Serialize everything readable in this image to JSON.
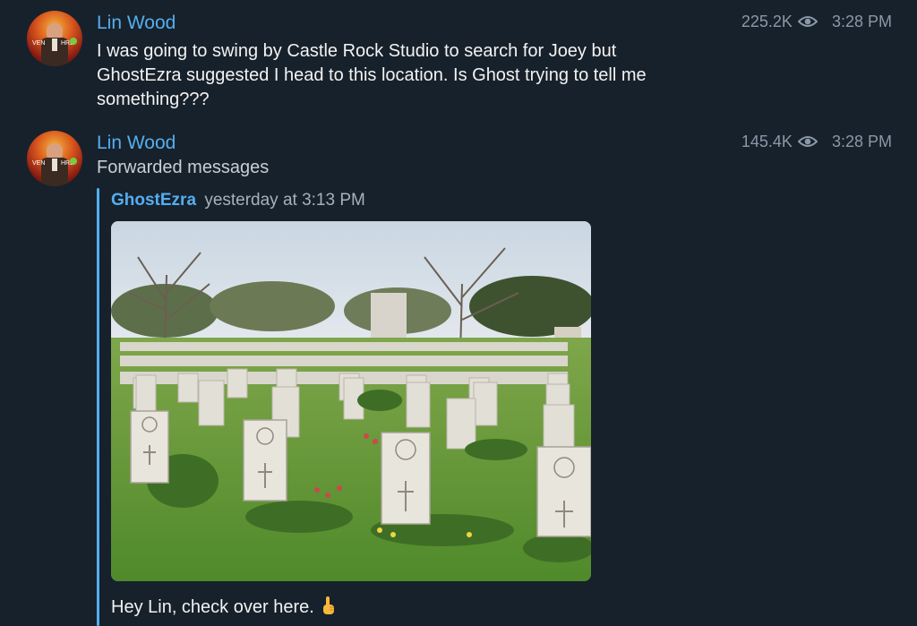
{
  "messages": [
    {
      "sender": "Lin Wood",
      "views": "225.2K",
      "time": "3:28 PM",
      "text_lines": [
        "I was going to swing by Castle Rock Studio to search for Joey but",
        "GhostEzra suggested I head to this location. Is Ghost trying to tell me",
        "something???"
      ]
    },
    {
      "sender": "Lin Wood",
      "views": "145.4K",
      "time": "3:28 PM",
      "forwarded_label": "Forwarded messages",
      "forward": {
        "from": "GhostEzra",
        "time": "yesterday at 3:13 PM",
        "caption": "Hey Lin, check over here."
      }
    }
  ],
  "icons": {
    "views": "eye-icon",
    "caption_emoji": "pointing-up-icon",
    "avatar": "avatar-image"
  },
  "colors": {
    "background": "#17212b",
    "accent": "#55aef0",
    "meta": "#8a98a8"
  }
}
